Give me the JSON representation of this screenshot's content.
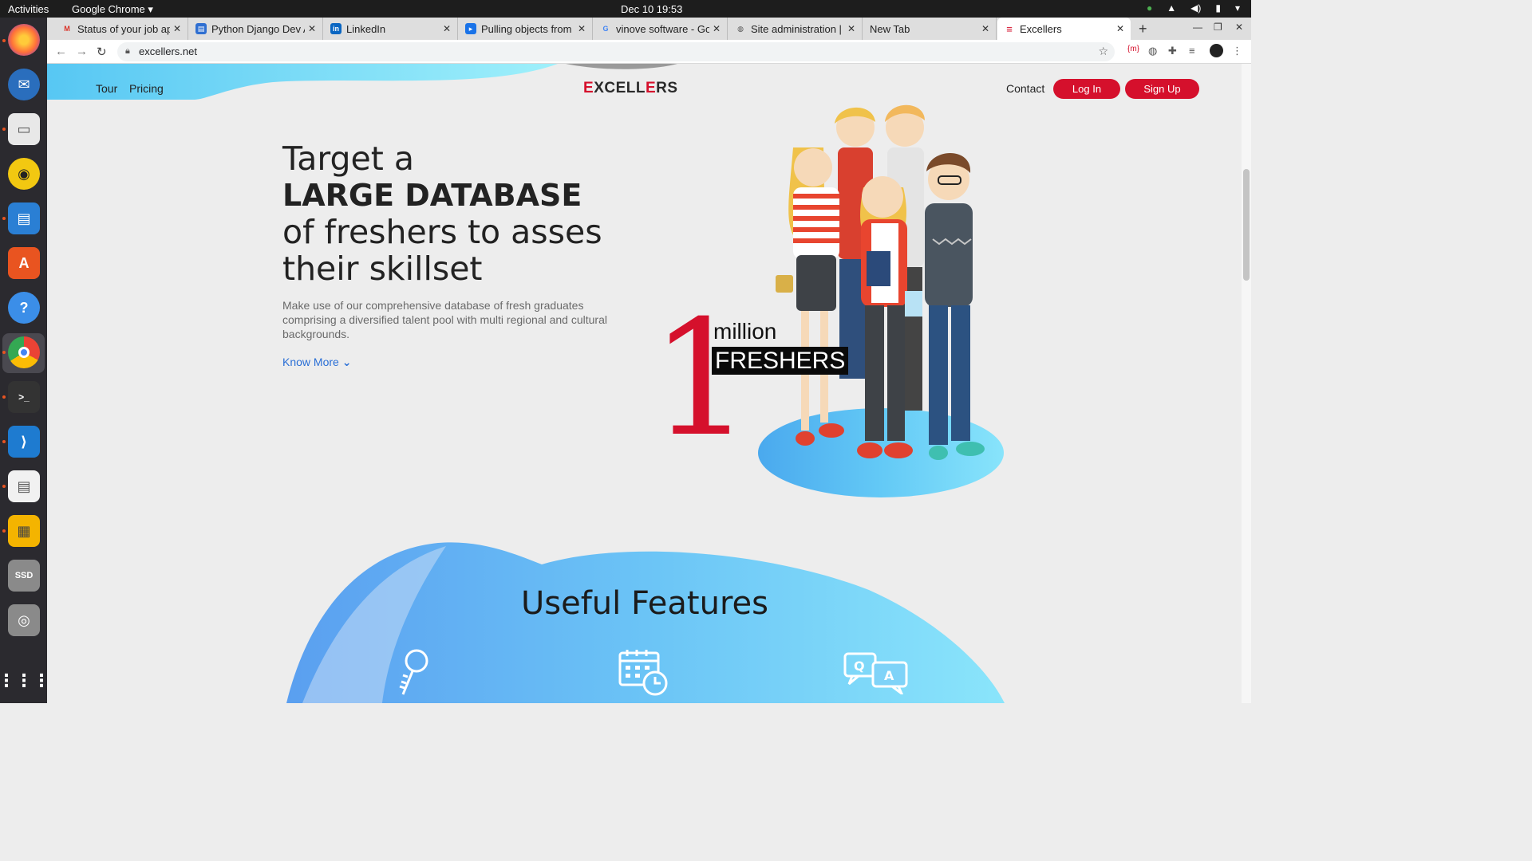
{
  "system": {
    "activities": "Activities",
    "app_menu": "Google Chrome ▾",
    "clock": "Dec 10  19:53"
  },
  "browser": {
    "tabs": [
      {
        "title": "Status of your job ap",
        "icon": "gmail-icon",
        "color": "#d93025"
      },
      {
        "title": "Python Django Dev A",
        "icon": "doc-icon",
        "color": "#2f6fd1"
      },
      {
        "title": "LinkedIn",
        "icon": "linkedin-icon",
        "color": "#0a66c2"
      },
      {
        "title": "Pulling objects from",
        "icon": "bookmark-icon",
        "color": "#1a73e8"
      },
      {
        "title": "vinove software - Go",
        "icon": "google-icon",
        "color": "#4285f4"
      },
      {
        "title": "Site administration |",
        "icon": "globe-icon",
        "color": "#555555"
      },
      {
        "title": "New Tab",
        "icon": "",
        "color": ""
      },
      {
        "title": "Excellers",
        "icon": "excellers-icon",
        "color": "#d5102c"
      }
    ],
    "url": "excellers.net"
  },
  "site": {
    "nav": {
      "tour": "Tour",
      "pricing": "Pricing",
      "contact": "Contact",
      "login": "Log In",
      "signup": "Sign Up"
    },
    "logo": {
      "prefix": "E",
      "mid": "XCELL",
      "e2": "E",
      "suffix": "RS"
    },
    "hero": {
      "line1": "Target a",
      "line2": "LARGE DATABASE",
      "line3": "of freshers to asses",
      "line4": "their skillset",
      "description": "Make use of our comprehensive database of fresh graduates comprising a diversified talent pool with multi regional and cultural backgrounds.",
      "know_more": "Know More"
    },
    "stat": {
      "number": "1",
      "unit": "million",
      "label": "FRESHERS"
    },
    "features": {
      "title": "Useful Features"
    }
  },
  "colors": {
    "brand": "#d5102c",
    "accent": "#4fc3f7"
  }
}
